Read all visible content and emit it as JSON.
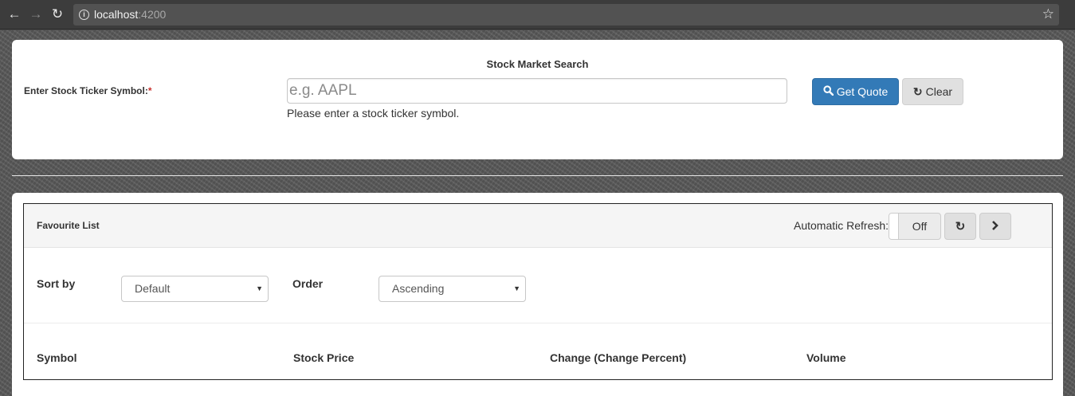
{
  "browser": {
    "url_host": "localhost",
    "url_port": ":4200"
  },
  "search": {
    "title": "Stock Market Search",
    "ticker_label": "Enter Stock Ticker Symbol:",
    "required_mark": "*",
    "input_placeholder": "e.g. AAPL",
    "input_value": "",
    "helper_text": "Please enter a stock ticker symbol.",
    "get_quote_label": "Get Quote",
    "clear_label": "Clear"
  },
  "favourites": {
    "title": "Favourite List",
    "auto_refresh_label": "Automatic Refresh:",
    "toggle_state": "Off",
    "sort_label": "Sort by",
    "sort_value": "Default",
    "order_label": "Order",
    "order_value": "Ascending",
    "columns": [
      "Symbol",
      "Stock Price",
      "Change (Change Percent)",
      "Volume"
    ]
  }
}
